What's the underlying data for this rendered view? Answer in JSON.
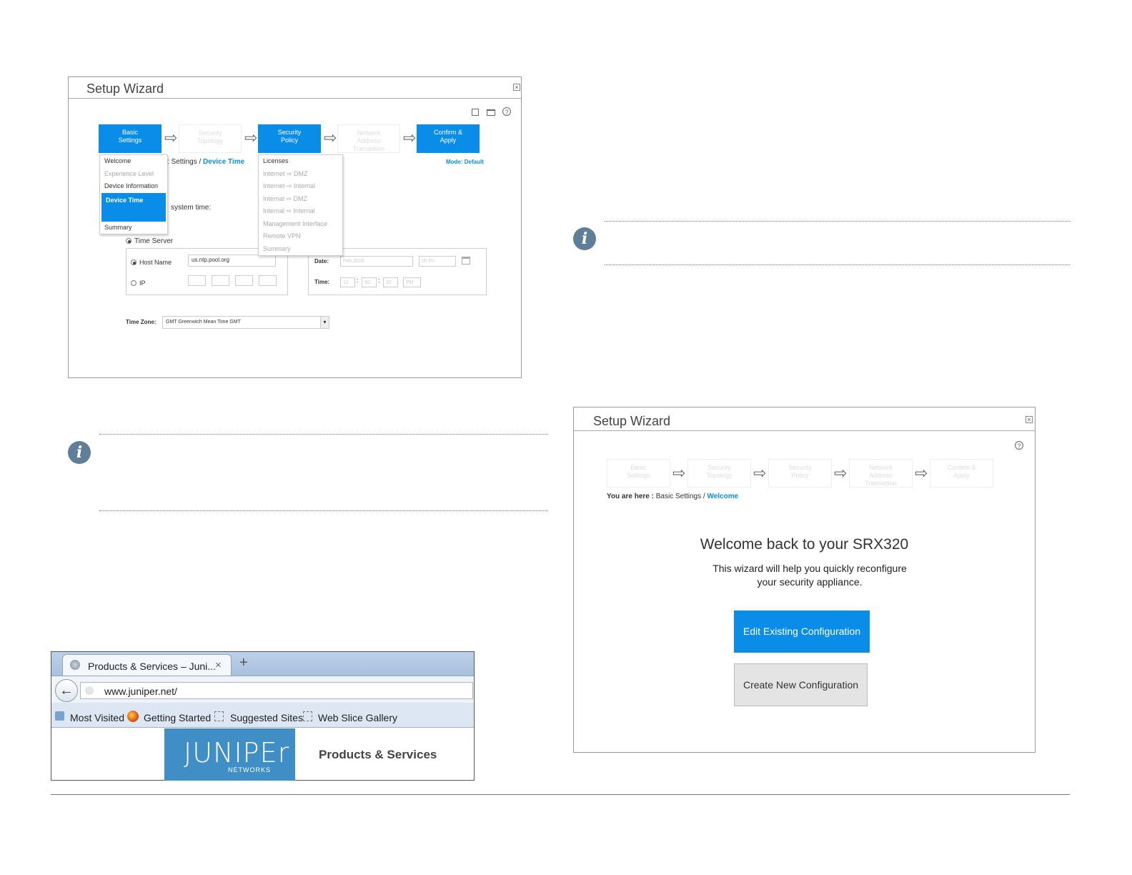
{
  "wizard1": {
    "title": "Setup Wizard",
    "close": "×",
    "steps": [
      {
        "label": "Basic\nSettings",
        "state": "active"
      },
      {
        "label": "Security\nTopology",
        "state": "inactive"
      },
      {
        "label": "Security\nPolicy",
        "state": "active"
      },
      {
        "label": "Network\nAddress\nTranslation",
        "state": "inactive"
      },
      {
        "label": "Confirm &\nApply",
        "state": "active"
      }
    ],
    "basic_menu": [
      {
        "label": "Welcome",
        "state": "normal"
      },
      {
        "label": "Experience Level",
        "state": "dim"
      },
      {
        "label": "Device Information",
        "state": "normal"
      },
      {
        "label": "Device Time",
        "state": "selected"
      },
      {
        "label": "Summary",
        "state": "normal"
      }
    ],
    "policy_menu": [
      {
        "label": "Licenses",
        "state": "normal"
      },
      {
        "label": "Internet ⇨ DMZ",
        "state": "dim"
      },
      {
        "label": "Internet ⇨ Internal",
        "state": "dim"
      },
      {
        "label": "Internal ⇨ DMZ",
        "state": "dim"
      },
      {
        "label": "Internal ⇨ Internal",
        "state": "dim"
      },
      {
        "label": "Management Interface",
        "state": "dim"
      },
      {
        "label": "Remote VPN",
        "state": "dim"
      },
      {
        "label": "Summary",
        "state": "dim"
      }
    ],
    "breadcrumb_tail": ": Settings / ",
    "breadcrumb_current": "Device Time",
    "mode": "Mode: Default",
    "system_time_text": "system time:",
    "time_server_label": "Time Server",
    "host_name_label": "Host Name",
    "host_name_value": "us.ntp.pool.org",
    "ip_label": "IP",
    "date_label": "Date:",
    "date_value": "Feb 2016",
    "date_day": "05 Fri",
    "time_label": "Time:",
    "time_h": "12",
    "time_m": "50",
    "time_s": "32",
    "time_ampm": "PM",
    "timezone_label": "Time Zone:",
    "timezone_value": "GMT Greenwich Mean Time GMT"
  },
  "browser": {
    "tab_title": "Products & Services – Juni...",
    "tab_close": "×",
    "new_tab": "+",
    "back": "←",
    "url": "www.juniper.net/",
    "bookmarks": [
      "Most Visited",
      "Getting Started",
      "Suggested Sites",
      "Web Slice Gallery"
    ],
    "logo_text": "JUNIPEr",
    "logo_sub": "NETWORKS",
    "page_heading": "Products & Services"
  },
  "wizard2": {
    "title": "Setup Wizard",
    "close": "×",
    "steps": [
      "Basic\nSettings",
      "Security\nTopology",
      "Security\nPolicy",
      "Network\nAddress\nTranslation",
      "Confirm &\nApply"
    ],
    "you_are_here": "You are here :",
    "breadcrumb_path": "Basic Settings / ",
    "breadcrumb_current": "Welcome",
    "heading": "Welcome back to your SRX320",
    "subtext_line1": "This wizard will help you quickly reconfigure",
    "subtext_line2": "your security appliance.",
    "edit_button": "Edit Existing Configuration",
    "create_button": "Create New Configuration"
  },
  "info_icon_glyph": "i",
  "colors": {
    "accent": "#0a8de8",
    "juniper_blue": "#3f8fc6",
    "info_icon": "#5f7f98"
  }
}
